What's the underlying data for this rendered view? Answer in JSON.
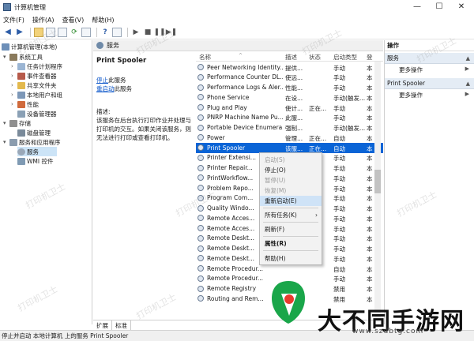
{
  "window": {
    "title": "计算机管理",
    "minimize": "—",
    "maximize": "☐",
    "close": "✕"
  },
  "menu": [
    "文件(F)",
    "操作(A)",
    "查看(V)",
    "帮助(H)"
  ],
  "tree": {
    "root": "计算机管理(本地)",
    "items": [
      "系统工具",
      "任务计划程序",
      "事件查看器",
      "共享文件夹",
      "本地用户和组",
      "性能",
      "设备管理器",
      "存储",
      "磁盘管理",
      "服务和应用程序",
      "服务",
      "WMI 控件"
    ]
  },
  "services_header": "服务",
  "detail": {
    "name": "Print Spooler",
    "stop_link": "停止",
    "stop_suffix": "此服务",
    "restart_link": "重启动",
    "restart_suffix": "此服务",
    "desc_label": "描述:",
    "desc_text": "该服务在后台执行打印作业并处理与打印机的交互。如果关闭该服务，则无法进行打印或查看打印机。"
  },
  "columns": [
    "名称",
    "描述",
    "状态",
    "启动类型",
    "登"
  ],
  "rows": [
    [
      "Peer Networking Identity...",
      "提供...",
      "",
      "手动",
      "本"
    ],
    [
      "Performance Counter DL...",
      "使远...",
      "",
      "手动",
      "本"
    ],
    [
      "Performance Logs & Aler...",
      "性能...",
      "",
      "手动",
      "本"
    ],
    [
      "Phone Service",
      "在设...",
      "",
      "手动(触发...",
      "本"
    ],
    [
      "Plug and Play",
      "使计...",
      "正在...",
      "手动",
      "本"
    ],
    [
      "PNRP Machine Name Pu...",
      "此服...",
      "",
      "手动",
      "本"
    ],
    [
      "Portable Device Enumera...",
      "强制...",
      "",
      "手动(触发...",
      "本"
    ],
    [
      "Power",
      "管理...",
      "正在...",
      "自动",
      "本"
    ],
    [
      "Print Spooler",
      "该服...",
      "正在...",
      "自动",
      "本"
    ],
    [
      "Printer Extensi...",
      "",
      "",
      "手动",
      "本"
    ],
    [
      "Printer Repair...",
      "",
      "",
      "手动",
      "本"
    ],
    [
      "PrintWorkflow...",
      "",
      "",
      "手动",
      "本"
    ],
    [
      "Problem Repo...",
      "",
      "",
      "手动",
      "本"
    ],
    [
      "Program Com...",
      "",
      "",
      "手动",
      "本"
    ],
    [
      "Quality Windo...",
      "",
      "",
      "手动",
      "本"
    ],
    [
      "Remote Acces...",
      "",
      "",
      "手动",
      "本"
    ],
    [
      "Remote Acces...",
      "",
      "",
      "手动",
      "本"
    ],
    [
      "Remote Deskt...",
      "",
      "",
      "手动",
      "本"
    ],
    [
      "Remote Deskt...",
      "",
      "",
      "手动",
      "本"
    ],
    [
      "Remote Deskt...",
      "",
      "",
      "手动",
      "本"
    ],
    [
      "Remote Procedur...",
      "",
      "",
      "自动",
      "本"
    ],
    [
      "Remote Procedur...",
      "",
      "",
      "手动",
      "本"
    ],
    [
      "Remote Registry",
      "",
      "",
      "禁用",
      "本"
    ],
    [
      "Routing and Rem...",
      "",
      "",
      "禁用",
      "本"
    ]
  ],
  "context_menu": {
    "start": "启动(S)",
    "stop": "停止(O)",
    "pause": "暂停(U)",
    "resume": "恢复(M)",
    "restart": "重新启动(E)",
    "all_tasks": "所有任务(K)",
    "refresh": "刷新(F)",
    "properties": "属性(R)",
    "help": "帮助(H)"
  },
  "tabs": [
    "扩展",
    "标准"
  ],
  "actions": {
    "header": "操作",
    "section1": "服务",
    "more1": "更多操作",
    "section2": "Print Spooler",
    "more2": "更多操作"
  },
  "status": "停止并启动 本地计算机 上的服务 Print Spooler",
  "watermark": "打印机卫士",
  "logo": {
    "text": "大不同手游网",
    "url": "www.szdbtg.com"
  },
  "colors": {
    "selection": "#0a64d6",
    "link": "#0a55c9",
    "highlight": "#cfe3f7"
  }
}
